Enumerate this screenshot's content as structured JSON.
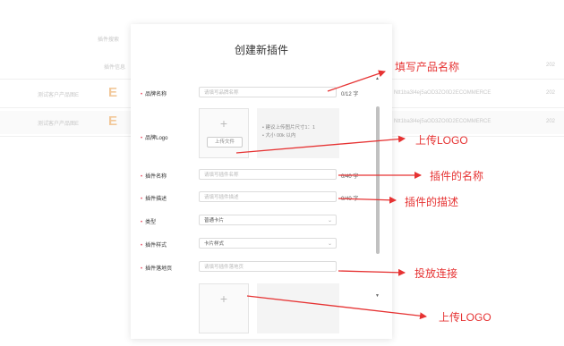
{
  "background": {
    "breadcrumb": "插件搜索",
    "header": "插件信息",
    "rows": [
      {
        "name": "测试客户产品图E",
        "code": "Ntt1ba3l4ej5aOD3ZO0D2ECOMMERCE",
        "year": "202"
      },
      {
        "name": "测试客户产品图E",
        "code": "Ntt1ba3l4ej5aOD3ZO0D2ECOMMERCE",
        "year": "202"
      }
    ],
    "header_year": "202",
    "icon_letter": "E"
  },
  "modal": {
    "title": "创建新插件",
    "fields": {
      "brand_name": {
        "label": "品牌名称",
        "placeholder": "请填写品牌名称",
        "count": "0/12 字"
      },
      "brand_logo": {
        "label": "品牌Logo",
        "upload_button": "上传文件",
        "hint_line1": "• 建议上传图片尺寸1：1",
        "hint_line2": "• 大小 00k 以内"
      },
      "plugin_name": {
        "label": "插件名称",
        "placeholder": "请填写插件名称",
        "count": "0/40 字"
      },
      "plugin_desc": {
        "label": "插件描述",
        "placeholder": "请填写插件描述",
        "count": "0/40 字"
      },
      "type": {
        "label": "类型",
        "value": "普通卡片"
      },
      "plugin_style": {
        "label": "插件样式",
        "value": "卡片样式"
      },
      "landing_page": {
        "label": "插件落地页",
        "placeholder": "请填写插件落地页"
      }
    }
  },
  "annotations": {
    "fill_product_name": "填写产品名称",
    "upload_logo": "上传LOGO",
    "plugin_name": "插件的名称",
    "plugin_desc": "插件的描述",
    "landing_link": "投放连接",
    "upload_logo_2": "上传LOGO"
  },
  "colors": {
    "annotation": "#e63333",
    "required": "#e84a5f"
  }
}
